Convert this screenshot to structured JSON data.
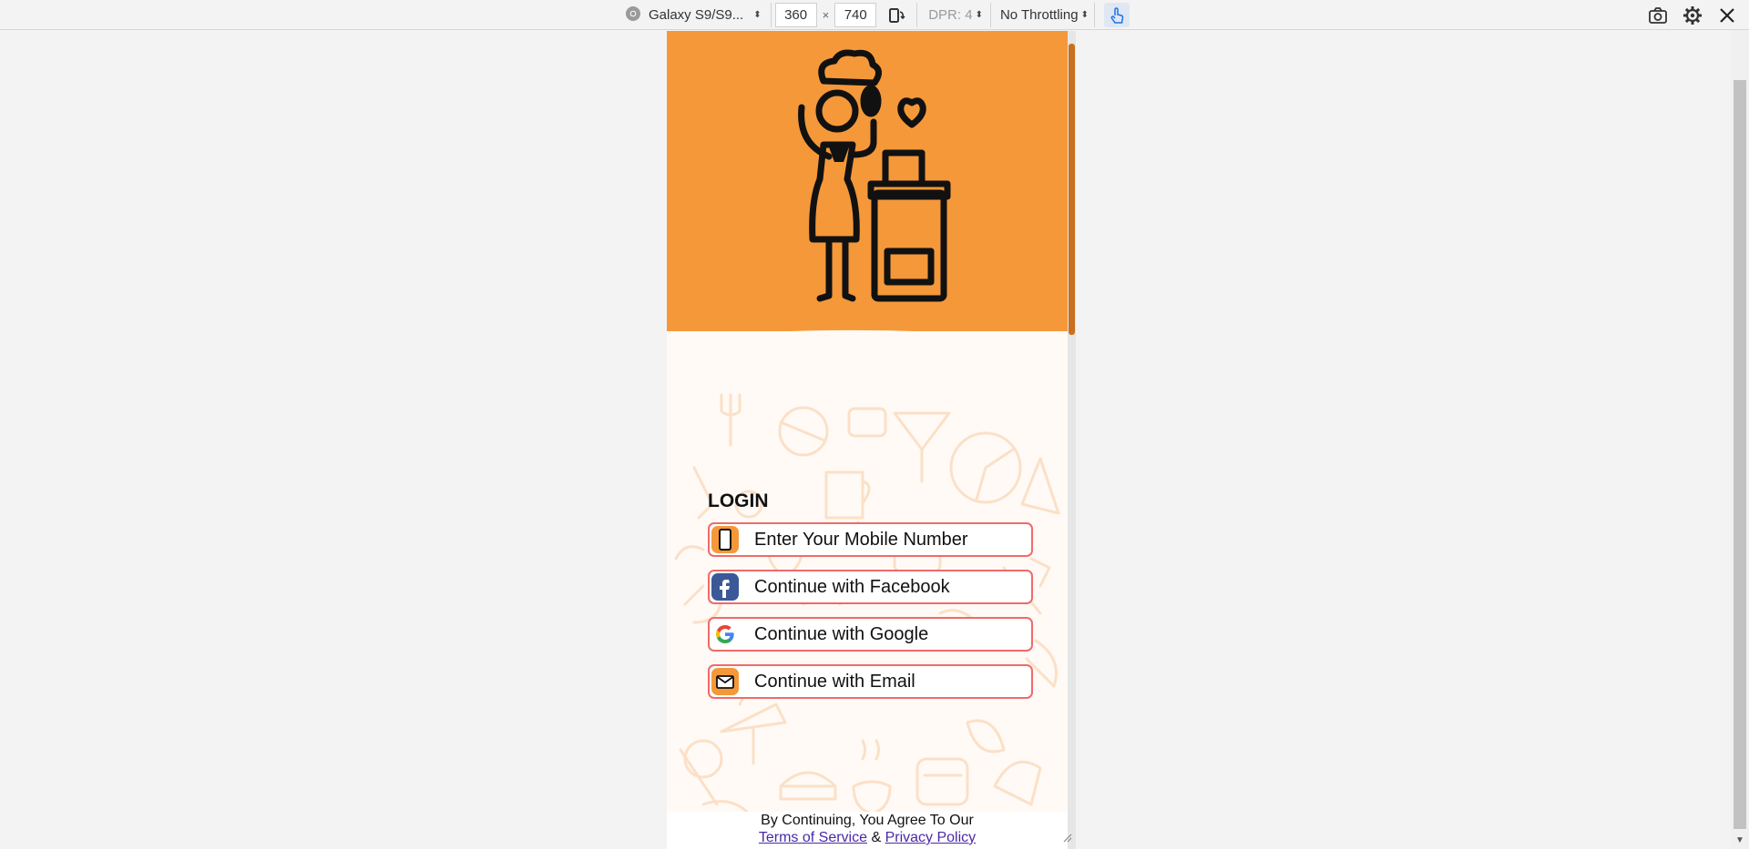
{
  "devtools": {
    "device_name": "Galaxy S9/S9...",
    "width": "360",
    "x_sep": "×",
    "height": "740",
    "dpr": "DPR: 4",
    "throttling": "No Throttling"
  },
  "login": {
    "title": "LOGIN",
    "buttons": [
      {
        "label": "Enter Your Mobile Number",
        "icon": "phone-icon"
      },
      {
        "label": "Continue with Facebook",
        "icon": "facebook-icon"
      },
      {
        "label": "Continue with Google",
        "icon": "google-icon"
      },
      {
        "label": "Continue with Email",
        "icon": "email-icon"
      }
    ]
  },
  "footer": {
    "agree_text": "By Continuing, You Agree To Our",
    "terms": "Terms of Service",
    "amp": " & ",
    "privacy": "Privacy Policy"
  },
  "colors": {
    "hero": "#f59839",
    "button_border": "#f06a6a",
    "link": "#4a2aa6"
  }
}
